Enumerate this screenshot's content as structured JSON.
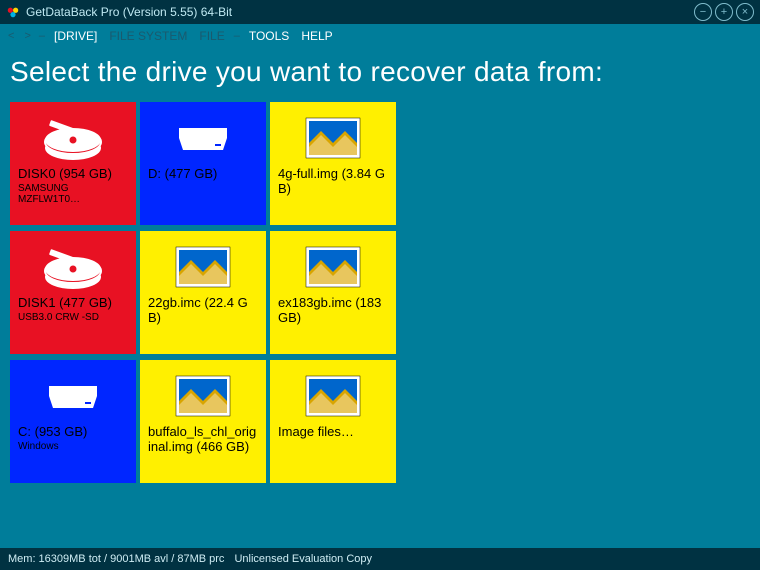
{
  "titlebar": {
    "title": "GetDataBack Pro (Version 5.55) 64-Bit"
  },
  "menubar": {
    "nav_back": "<",
    "nav_fwd": ">",
    "sep": "–",
    "items": [
      {
        "label": "[DRIVE]",
        "state": "active"
      },
      {
        "label": "FILE SYSTEM",
        "state": "dim"
      },
      {
        "label": "FILE",
        "state": "dim"
      },
      {
        "label": "TOOLS",
        "state": "active"
      },
      {
        "label": "HELP",
        "state": "active"
      }
    ]
  },
  "heading": "Select the drive you want to recover data from:",
  "tiles": [
    {
      "color": "red",
      "icon": "hdd",
      "label": "DISK0 (954 GB)",
      "sub": "SAMSUNG MZFLW1T0…"
    },
    {
      "color": "blue",
      "icon": "drive",
      "label": "D: (477 GB)",
      "sub": ""
    },
    {
      "color": "yellow",
      "icon": "image",
      "label": "4g-full.img (3.84 GB)",
      "sub": ""
    },
    {
      "color": "red",
      "icon": "hdd",
      "label": "DISK1 (477 GB)",
      "sub": "USB3.0 CRW   -SD"
    },
    {
      "color": "yellow",
      "icon": "image",
      "label": "22gb.imc (22.4 GB)",
      "sub": ""
    },
    {
      "color": "yellow",
      "icon": "image",
      "label": "ex183gb.imc (183 GB)",
      "sub": ""
    },
    {
      "color": "blue",
      "icon": "drive",
      "label": "C: (953 GB)",
      "sub": "Windows"
    },
    {
      "color": "yellow",
      "icon": "image",
      "label": "buffalo_ls_chl_original.img (466 GB)",
      "sub": ""
    },
    {
      "color": "yellow",
      "icon": "image",
      "label": "Image files…",
      "sub": ""
    }
  ],
  "statusbar": {
    "mem": "Mem: 16309MB tot / 9001MB avl / 87MB prc",
    "lic": "Unlicensed Evaluation Copy"
  },
  "icons": {
    "minimize": "−",
    "maximize": "+",
    "close": "×"
  }
}
